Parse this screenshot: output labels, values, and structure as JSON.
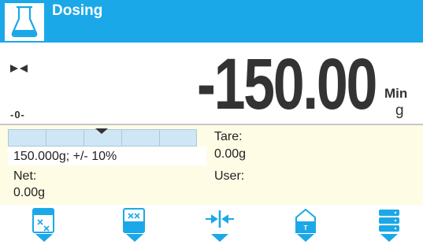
{
  "header": {
    "title": "Dosing",
    "app_icon": "flask-icon",
    "color": "#1ba8e8"
  },
  "readout": {
    "value": "-150.00",
    "min_label": "Min",
    "unit": "g",
    "stable_icon": "stability-icon",
    "zero_icon": "zero-indicator-icon",
    "zero_label": "-0-"
  },
  "info": {
    "threshold": "150.000g; +/- 10%",
    "net_label": "Net:",
    "net_value": "0.00g",
    "tare_label": "Tare:",
    "tare_value": "0.00g",
    "user_label": "User:",
    "user_value": "",
    "background": "#fffce6"
  },
  "toolbar": {
    "keys": [
      {
        "icon": "dosing-substance-icon"
      },
      {
        "icon": "dosing-substance-select-icon"
      },
      {
        "icon": "zero-icon"
      },
      {
        "icon": "tare-icon"
      },
      {
        "icon": "database-icon"
      }
    ],
    "accent": "#1ba8e8"
  }
}
